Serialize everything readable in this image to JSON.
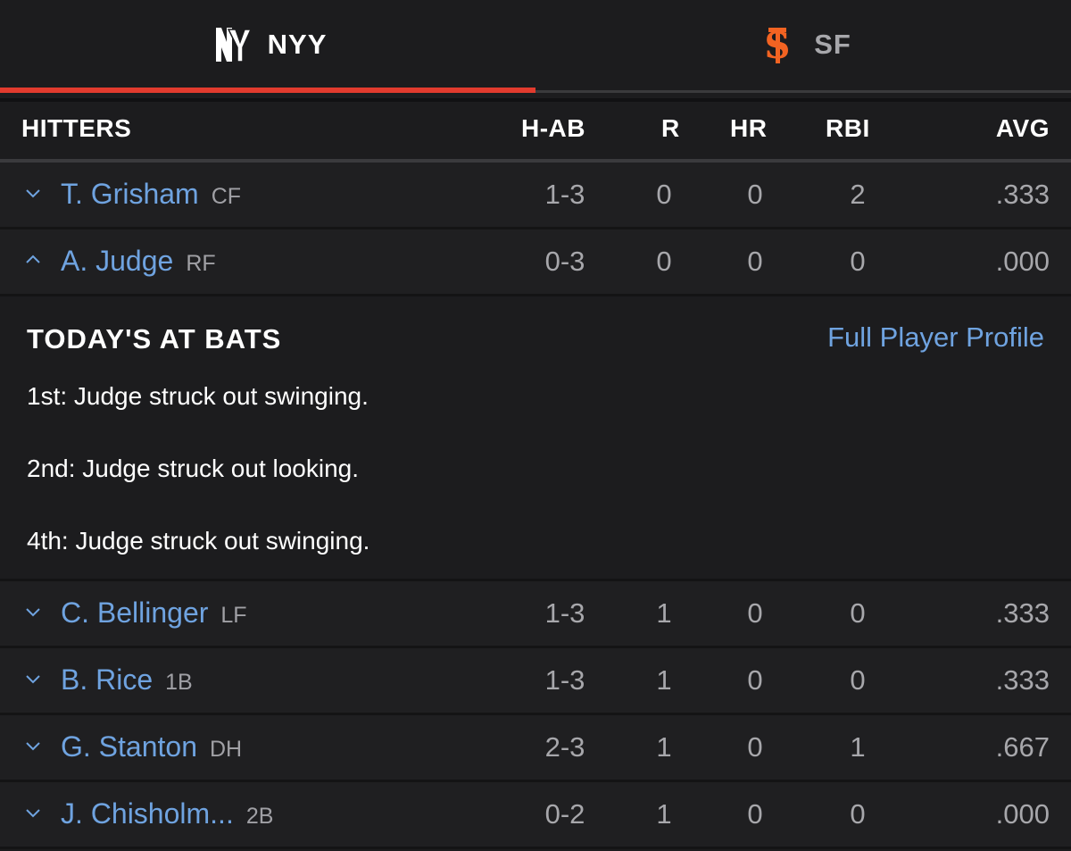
{
  "tabs": [
    {
      "label": "NYY",
      "icon": "yankees-logo-icon",
      "active": true
    },
    {
      "label": "SF",
      "icon": "giants-logo-icon",
      "active": false
    }
  ],
  "colors": {
    "accent": "#e23b2e",
    "link": "#6fa3e0",
    "giants_orange": "#f26322"
  },
  "header": {
    "hitters": "HITTERS",
    "hab": "H-AB",
    "r": "R",
    "hr": "HR",
    "rbi": "RBI",
    "avg": "AVG"
  },
  "players": [
    {
      "name": "T. Grisham",
      "pos": "CF",
      "hab": "1-3",
      "r": "0",
      "hr": "0",
      "rbi": "2",
      "avg": ".333",
      "expanded": false
    },
    {
      "name": "A. Judge",
      "pos": "RF",
      "hab": "0-3",
      "r": "0",
      "hr": "0",
      "rbi": "0",
      "avg": ".000",
      "expanded": true
    },
    {
      "name": "C. Bellinger",
      "pos": "LF",
      "hab": "1-3",
      "r": "1",
      "hr": "0",
      "rbi": "0",
      "avg": ".333",
      "expanded": false
    },
    {
      "name": "B. Rice",
      "pos": "1B",
      "hab": "1-3",
      "r": "1",
      "hr": "0",
      "rbi": "0",
      "avg": ".333",
      "expanded": false
    },
    {
      "name": "G. Stanton",
      "pos": "DH",
      "hab": "2-3",
      "r": "1",
      "hr": "0",
      "rbi": "1",
      "avg": ".667",
      "expanded": false
    },
    {
      "name": "J. Chisholm...",
      "pos": "2B",
      "hab": "0-2",
      "r": "1",
      "hr": "0",
      "rbi": "0",
      "avg": ".000",
      "expanded": false
    }
  ],
  "at_bats": {
    "title": "TODAY'S AT BATS",
    "profile_link": "Full Player Profile",
    "items": [
      "1st: Judge struck out swinging.",
      "2nd: Judge struck out looking.",
      "4th: Judge struck out swinging."
    ]
  }
}
